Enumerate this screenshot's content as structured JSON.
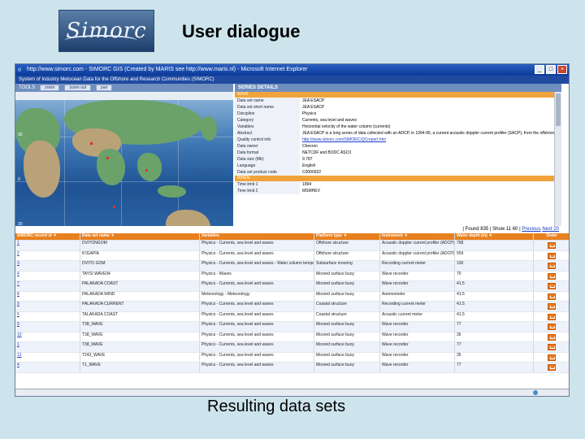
{
  "slide": {
    "logo_text": "Simorc",
    "title": "User dialogue",
    "caption": "Resulting data sets"
  },
  "browser": {
    "title": "http://www.simorc.com - SIMORC GIS (Created by MARIS see http://www.maris.nl) - Microsoft Internet Explorer",
    "app_banner": "System of Industry Metocean Data for the Offshore and Research Communities (SIMORC)",
    "status_text": ""
  },
  "tools": {
    "label": "TOOLS",
    "buttons": [
      "zoom",
      "zoom out",
      "pan"
    ]
  },
  "map": {
    "lon_labels": [
      "90",
      "0",
      "60"
    ],
    "lat_labels": [
      "30",
      "0",
      "30"
    ]
  },
  "series_details": {
    "header": "SERIES DETAILS",
    "section_what": "WHAT",
    "section_when": "WHEN",
    "fields": [
      {
        "k": "Data set name",
        "v": "JEA ESACP"
      },
      {
        "k": "Data set short name",
        "v": "JEA ESACP"
      },
      {
        "k": "Discipline",
        "v": "Physics"
      },
      {
        "k": "Category",
        "v": "Currents, sea level and waves"
      },
      {
        "k": "Variables",
        "v": "Horizontal velocity of the water column (currents)"
      },
      {
        "k": "Abstract",
        "v": "JEA ESACP is a long series of data collected with an ADCP, in 1994-95, a current acoustic doppler current profiler (SACP), from the offshore structure."
      },
      {
        "k": "Quality control info",
        "v": "http://www.simorc.com/SIMORC/QCreport.htm",
        "link": true
      },
      {
        "k": "Data owner",
        "v": "Chevron"
      },
      {
        "k": "Data format",
        "v": "NETCDF and BODC ASCII"
      },
      {
        "k": "Data size (Mb)",
        "v": "9.787"
      },
      {
        "k": "Language",
        "v": "English"
      },
      {
        "k": "Data set product code",
        "v": "C0000922"
      }
    ],
    "when_fields": [
      {
        "k": "Time limit 1",
        "v": "1994"
      },
      {
        "k": "Time limit 2",
        "v": "MSMHEV"
      }
    ]
  },
  "pager": {
    "found": "| Found 835 | Show 11 60 |",
    "previous": "Previous",
    "next": "Next 20"
  },
  "table": {
    "headers": [
      "SIMORC record id ▼",
      "Data set name ▼",
      "Variables",
      "Platform type ▼",
      "Instrument ▼",
      "Water depth (m) ▼",
      "Order"
    ],
    "rows": [
      [
        "1",
        "DVITONGOM",
        "Physics - Currents, sea level and waves",
        "Offshore structure",
        "Acoustic doppler current profiler (ADCP)",
        "768",
        ""
      ],
      [
        "2",
        "K'IGAPIA",
        "Physics - Currents, sea level and waves",
        "Offshore structure",
        "Acoustic doppler current profiler (ADCP)",
        "559",
        ""
      ],
      [
        "3",
        "DVITO GOM",
        "Physics - Currents, sea level and waves - Water column temperature and salinity",
        "Subsurface mooring",
        "Recording current meter",
        "100",
        ""
      ],
      [
        "4",
        "TAYSI WAVE94",
        "Physics - Waves",
        "Moored surface buoy",
        "Wave recorder",
        "70",
        ""
      ],
      [
        "7",
        "PALAKADA COAST",
        "Physics - Currents, sea level and waves",
        "Moored surface buoy",
        "Wave recorder",
        "41.5",
        ""
      ],
      [
        "8",
        "PALAKADA WIND",
        "Meteorology - Meteorology",
        "Moored surface buoy",
        "Anemometer",
        "41.5",
        ""
      ],
      [
        "9",
        "PALAKADA CURRENT",
        "Physics - Currents, sea level and waves",
        "Coastal structure",
        "Recording current meter",
        "41.5",
        ""
      ],
      [
        "5",
        "TALAKADA COAST",
        "Physics - Currents, sea level and waves",
        "Coastal structure",
        "Acoustic current meter",
        "41.5",
        ""
      ],
      [
        "9",
        "T38_WAVE",
        "Physics - Currents, sea level and waves",
        "Moored surface buoy",
        "Wave recorder",
        "77",
        ""
      ],
      [
        "10",
        "T38_WAVE",
        "Physics - Currents, sea level and waves",
        "Moored surface buoy",
        "Wave recorder",
        "35",
        ""
      ],
      [
        "1",
        "T38_WAVE",
        "Physics - Currents, sea level and waves",
        "Moored surface buoy",
        "Wave recorder",
        "77",
        ""
      ],
      [
        "12",
        "T243_WAVE",
        "Physics - Currents, sea level and waves",
        "Moored surface buoy",
        "Wave recorder",
        "35",
        ""
      ],
      [
        "4",
        "T1_WAVE",
        "Physics - Currents, sea level and waves",
        "Moored surface buoy",
        "Wave recorder",
        "77",
        ""
      ]
    ]
  },
  "colors": {
    "orange_accent": "#e8801f",
    "blue_header": "#6f8fbf",
    "title_blue": "#0a3a9a"
  }
}
